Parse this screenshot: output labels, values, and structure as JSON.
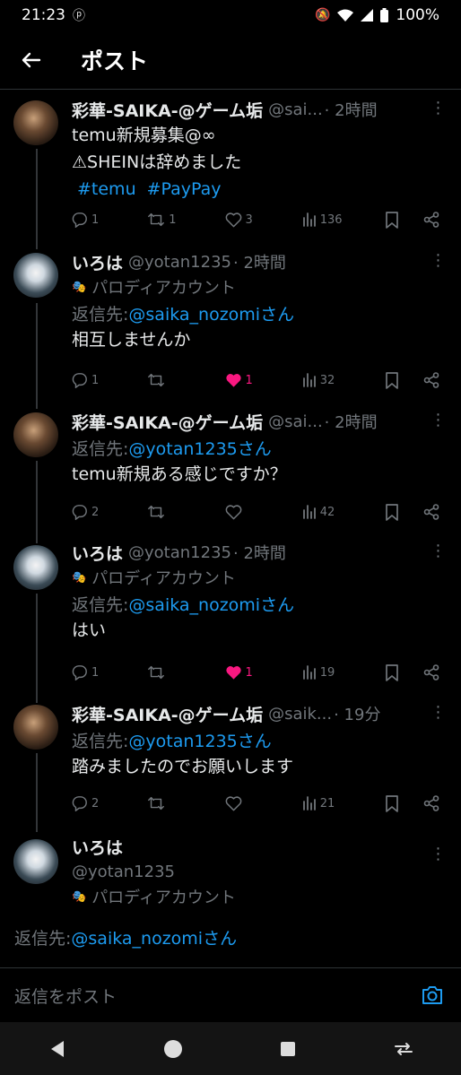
{
  "status_bar": {
    "time": "21:23",
    "battery": "100%"
  },
  "header": {
    "title": "ポスト"
  },
  "tweets": [
    {
      "name": "彩華-SAIKA-@ゲーム垢",
      "handle": "@sai...",
      "time": "· 2時間",
      "lines": [
        "temu新規募集@∞",
        "⚠SHEINは辞めました"
      ],
      "hashtags": [
        "#temu",
        "#PayPay"
      ],
      "stats": {
        "replies": "1",
        "reposts": "1",
        "likes": "3",
        "views": "136"
      }
    },
    {
      "name": "いろは",
      "handle": "@yotan1235",
      "time": "· 2時間",
      "parody": "パロディアカウント",
      "reply_prefix": "返信先: ",
      "reply_to": "@saika_nozomiさん",
      "text": "相互しませんか",
      "stats": {
        "replies": "1",
        "reposts": "",
        "likes": "1",
        "views": "32"
      }
    },
    {
      "name": "彩華-SAIKA-@ゲーム垢",
      "handle": "@sai...",
      "time": "· 2時間",
      "reply_prefix": "返信先: ",
      "reply_to": "@yotan1235さん",
      "text": "temu新規ある感じですか？",
      "stats": {
        "replies": "2",
        "reposts": "",
        "likes": "",
        "views": "42"
      }
    },
    {
      "name": "いろは",
      "handle": "@yotan1235",
      "time": "· 2時間",
      "parody": "パロディアカウント",
      "reply_prefix": "返信先: ",
      "reply_to": "@saika_nozomiさん",
      "text": "はい",
      "stats": {
        "replies": "1",
        "reposts": "",
        "likes": "1",
        "views": "19"
      }
    },
    {
      "name": "彩華-SAIKA-@ゲーム垢",
      "handle": "@saik...",
      "time": "· 19分",
      "reply_prefix": "返信先: ",
      "reply_to": "@yotan1235さん",
      "text": "踏みましたのでお願いします",
      "stats": {
        "replies": "2",
        "reposts": "",
        "likes": "",
        "views": "21"
      }
    }
  ],
  "focused": {
    "name": "いろは",
    "handle": "@yotan1235",
    "parody": "パロディアカウント",
    "reply_prefix": "返信先: ",
    "reply_to": "@saika_nozomiさん"
  },
  "composer": {
    "placeholder": "返信をポスト"
  },
  "colors": {
    "accent": "#1d9bf0",
    "like": "#f91880",
    "muted": "#71767b",
    "background": "#000000"
  }
}
